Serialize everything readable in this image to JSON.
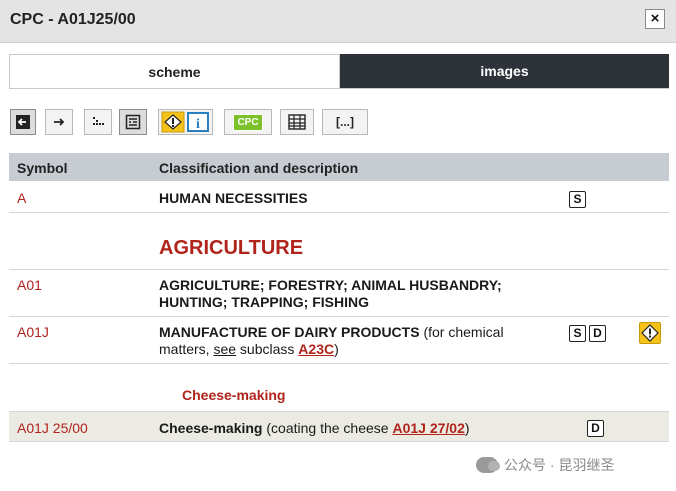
{
  "dialog": {
    "title": "CPC - A01J25/00",
    "close_label": "×"
  },
  "tabs": [
    {
      "label": "scheme"
    },
    {
      "label": "images"
    }
  ],
  "toolbar": {
    "cpc_label": "CPC",
    "bracket_label": "[...]"
  },
  "table": {
    "headers": {
      "symbol": "Symbol",
      "description": "Classification and description"
    },
    "rows": [
      {
        "symbol": "A",
        "title": "HUMAN NECESSITIES",
        "icons": [
          "S"
        ]
      },
      {
        "symbol": "A01",
        "title_line1": "AGRICULTURE; FORESTRY; ANIMAL HUSBANDRY;",
        "title_line2": "HUNTING; TRAPPING; FISHING"
      },
      {
        "symbol": "A01J",
        "title": "MANUFACTURE OF DAIRY PRODUCTS",
        "note_open": " (for chemical",
        "note_line2_pre": "matters, ",
        "see": "see",
        "note_mid": " subclass ",
        "ref": "A23C",
        "note_close": ")",
        "icons": [
          "S",
          "D"
        ]
      },
      {
        "symbol": "A01J 25/00",
        "title": "Cheese-making",
        "note_open": " (coating the cheese ",
        "ref": "A01J 27/02",
        "note_close": ")",
        "icons": [
          "D"
        ]
      }
    ],
    "headings": {
      "agriculture": "AGRICULTURE",
      "cheese_making": "Cheese-making"
    }
  },
  "watermark": {
    "text": "公众号 · 昆羽继圣"
  }
}
